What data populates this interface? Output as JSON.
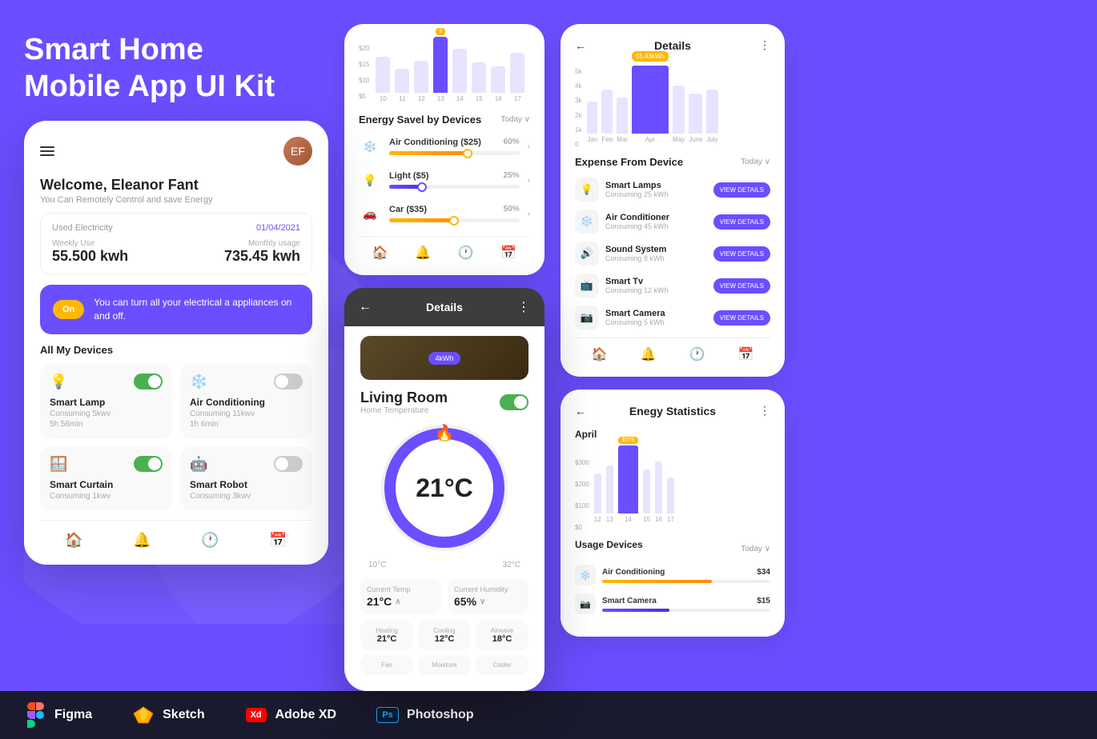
{
  "hero": {
    "title_line1": "Smart Home",
    "title_line2": "Mobile App UI Kit"
  },
  "phone_main": {
    "welcome": "Welcome, Eleanor Fant",
    "sub": "You Can Remotely Control and save Energy",
    "electricity_label": "Used Electricity",
    "electricity_date": "01/04/2021",
    "weekly_label": "Weekly Use",
    "monthly_label": "Monthly usage",
    "weekly_value": "55.500 kwh",
    "monthly_value": "735.45 kwh",
    "banner_text": "You can turn all your electrical a appliances on and off.",
    "on_badge": "On",
    "devices_title": "All My Devices",
    "devices": [
      {
        "name": "Smart Lamp",
        "info1": "Consuming 5kwv",
        "info2": "5h 56min",
        "on": true,
        "icon": "💡"
      },
      {
        "name": "Air Conditioning",
        "info1": "Consuming 11kwv",
        "info2": "1h 6min",
        "on": false,
        "icon": "❄️"
      },
      {
        "name": "Smart Curtain",
        "info1": "Consuming 1kwv",
        "on": true,
        "icon": "🪟"
      },
      {
        "name": "Smart Robot",
        "info1": "Consuming 3kwv",
        "on": false,
        "icon": "🤖"
      }
    ]
  },
  "energy_saved": {
    "title": "Energy Savel by Devices",
    "today": "Today",
    "chart_labels": [
      "10",
      "11",
      "12",
      "13",
      "14",
      "15",
      "16",
      "17"
    ],
    "chart_values": [
      60,
      40,
      55,
      90,
      70,
      50,
      45,
      65
    ],
    "chart_active": 3,
    "y_labels": [
      "$20",
      "$15",
      "$10",
      "$5",
      ""
    ],
    "devices": [
      {
        "name": "Air Conditioning ($25)",
        "pct": "60%",
        "fill": 60,
        "icon": "❄️"
      },
      {
        "name": "Light ($5)",
        "pct": "25%",
        "fill": 25,
        "icon": "💡"
      },
      {
        "name": "Car ($35)",
        "pct": "50%",
        "fill": 50,
        "icon": "🚗"
      }
    ]
  },
  "living_room": {
    "title": "Living Room",
    "sub": "Home Temperature",
    "temp": "21°C",
    "min_temp": "10°C",
    "max_temp": "32°C",
    "current_temp_label": "Current Temp",
    "current_temp": "21°C",
    "current_humidity_label": "Current Humidity",
    "current_humidity": "65%",
    "modes": [
      {
        "label": "Heating",
        "value": "21°C"
      },
      {
        "label": "Cooling",
        "value": "12°C"
      },
      {
        "label": "Airwave",
        "value": "18°C"
      }
    ],
    "extra": [
      {
        "label": "Fan"
      },
      {
        "label": "Moisture"
      },
      {
        "label": "Cooler"
      }
    ]
  },
  "details_right": {
    "title": "Details",
    "kwh_badge": "55.43kWh",
    "chart_labels": [
      "Jan",
      "Feb",
      "Mar",
      "Apr",
      "May",
      "June",
      "July"
    ],
    "expense_title": "Expense From Device",
    "today": "Today",
    "devices": [
      {
        "name": "Smart Lamps",
        "sub": "Consuming 25 kWh",
        "icon": "💡"
      },
      {
        "name": "Air Conditioner",
        "sub": "Consuming 45 kWh",
        "icon": "❄️"
      },
      {
        "name": "Sound System",
        "sub": "Consuming 8 kWh",
        "icon": "🔊"
      },
      {
        "name": "Smart Tv",
        "sub": "Consuming 12 kWh",
        "icon": "📺"
      },
      {
        "name": "Smart Camera",
        "sub": "Consuming 5 kWh",
        "icon": "📷"
      }
    ],
    "view_btn": "VIEW DETAILS"
  },
  "energy_stats": {
    "title": "Enegy Statistics",
    "period": "April",
    "badge": "$278",
    "chart_labels": [
      "12",
      "13",
      "14",
      "15",
      "16",
      "17"
    ],
    "chart_values": [
      55,
      65,
      95,
      60,
      70,
      50
    ],
    "highlight": 2,
    "y_labels": [
      "$300",
      "$200",
      "$100",
      "$0"
    ],
    "usage_title": "Usage Devices",
    "today": "Today",
    "usages": [
      {
        "name": "Air Conditioning",
        "amount": "$34",
        "fill": 65,
        "icon": "❄️"
      },
      {
        "name": "Smart Camera",
        "amount": "$15",
        "fill": 40,
        "icon": "📷"
      }
    ]
  },
  "tools": [
    {
      "name": "Figma",
      "type": "figma"
    },
    {
      "name": "Sketch",
      "type": "sketch"
    },
    {
      "name": "Adobe XD",
      "type": "xd"
    },
    {
      "name": "Photoshop",
      "type": "ps"
    }
  ]
}
